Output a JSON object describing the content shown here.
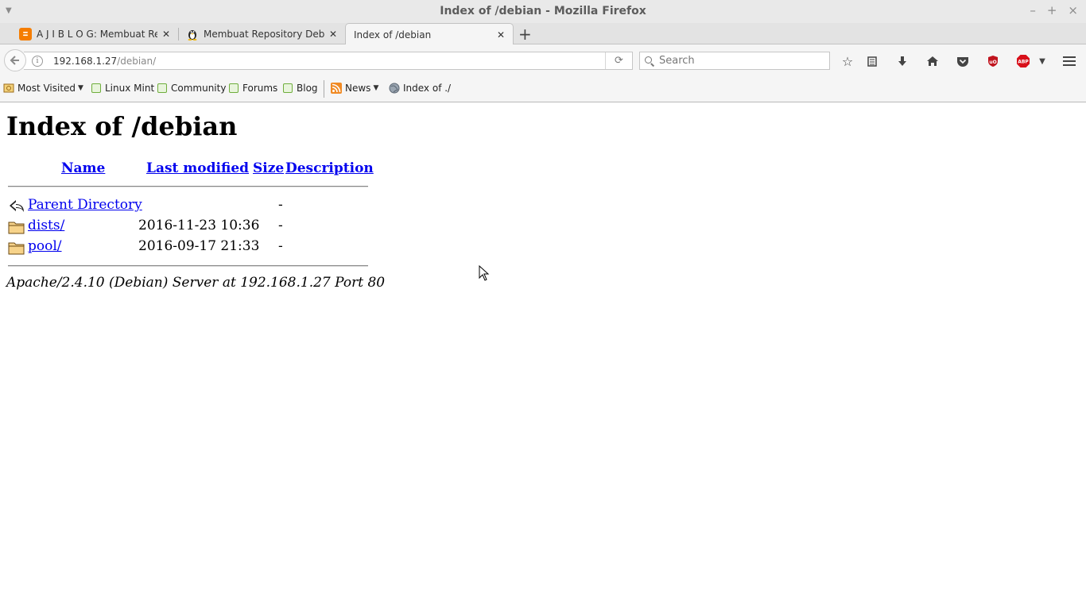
{
  "window": {
    "title": "Index of /debian - Mozilla Firefox",
    "controls": [
      "–",
      "+",
      "×"
    ]
  },
  "tabs": [
    {
      "label": "A J I B L O G: Membuat Re...",
      "icon": "blogger-icon",
      "color": "#f57d00"
    },
    {
      "label": "Membuat Repository Deb...",
      "icon": "tux-icon",
      "color": "#333333"
    },
    {
      "label": "Index of /debian",
      "icon": "none",
      "active": true
    }
  ],
  "navbar": {
    "url_host": "192.168.1.27",
    "url_path": "/debian/",
    "search_placeholder": "Search"
  },
  "bookmarks": [
    {
      "label": "Most Visited",
      "icon": "most-visited-icon",
      "dropdown": true
    },
    {
      "label": "Linux Mint",
      "icon": "mint-icon"
    },
    {
      "label": "Community",
      "icon": "mint-icon"
    },
    {
      "label": "Forums",
      "icon": "mint-icon"
    },
    {
      "label": "Blog",
      "icon": "mint-icon"
    },
    {
      "label": "News",
      "icon": "rss-icon",
      "dropdown": true
    },
    {
      "label": "Index of ./",
      "icon": "globe-icon"
    }
  ],
  "page": {
    "heading": "Index of /debian",
    "columns": {
      "name": "Name",
      "last_modified": "Last modified",
      "size": "Size",
      "description": "Description"
    },
    "rows": [
      {
        "name": "Parent Directory",
        "date": "",
        "size": "-",
        "icon": "parent-directory-icon"
      },
      {
        "name": "dists/",
        "date": "2016-11-23 10:36",
        "size": "-",
        "icon": "folder-icon"
      },
      {
        "name": "pool/",
        "date": "2016-09-17 21:33",
        "size": "-",
        "icon": "folder-icon"
      }
    ],
    "address": "Apache/2.4.10 (Debian) Server at 192.168.1.27 Port 80"
  },
  "colors": {
    "link": "#0000ee",
    "chrome": "#f5f5f5",
    "ublock": "#c0141e",
    "abp": "#d8101a"
  }
}
